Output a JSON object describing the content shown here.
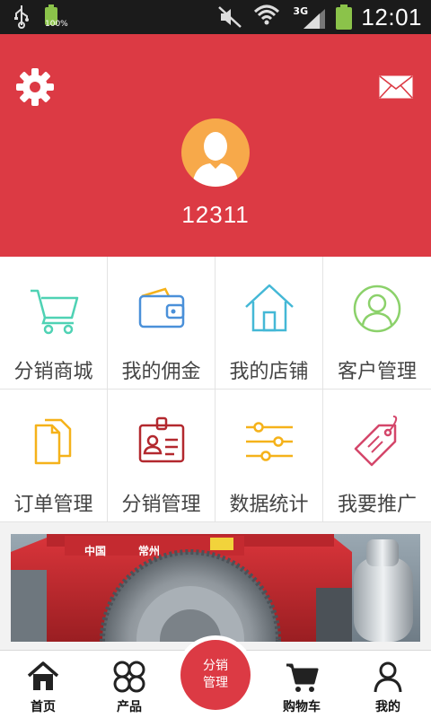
{
  "status_bar": {
    "battery_percent_label": "100%",
    "network_label": "3G",
    "time": "12:01",
    "icons": [
      "usb-icon",
      "battery-icon",
      "mute-icon",
      "wifi-icon",
      "signal-icon",
      "battery-icon"
    ]
  },
  "header": {
    "background_color": "#dc3a44",
    "username": "12311",
    "icons": [
      "gear-icon",
      "mail-icon",
      "avatar-icon"
    ]
  },
  "grid": {
    "items": [
      {
        "label": "分销商城",
        "icon": "cart-icon",
        "color": "#4fd2b4"
      },
      {
        "label": "我的佣金",
        "icon": "wallet-icon",
        "color": "#4a90d9"
      },
      {
        "label": "我的店铺",
        "icon": "home-icon",
        "color": "#44b8d6"
      },
      {
        "label": "客户管理",
        "icon": "user-circle-icon",
        "color": "#8bd16a"
      },
      {
        "label": "订单管理",
        "icon": "documents-icon",
        "color": "#f5b21a"
      },
      {
        "label": "分销管理",
        "icon": "id-badge-icon",
        "color": "#b3282e"
      },
      {
        "label": "数据统计",
        "icon": "sliders-icon",
        "color": "#f5b21a"
      },
      {
        "label": "我要推广",
        "icon": "tag-icon",
        "color": "#d4466a"
      }
    ]
  },
  "banner": {
    "caption_left": "中国",
    "caption_mid": "常州"
  },
  "bottom_nav": {
    "items": [
      {
        "label": "首页",
        "icon": "home-icon"
      },
      {
        "label": "产品",
        "icon": "products-grid-icon"
      },
      {
        "label": "购物车",
        "icon": "cart-icon"
      },
      {
        "label": "我的",
        "icon": "person-icon"
      }
    ],
    "center": {
      "line1": "分销",
      "line2": "管理"
    }
  }
}
